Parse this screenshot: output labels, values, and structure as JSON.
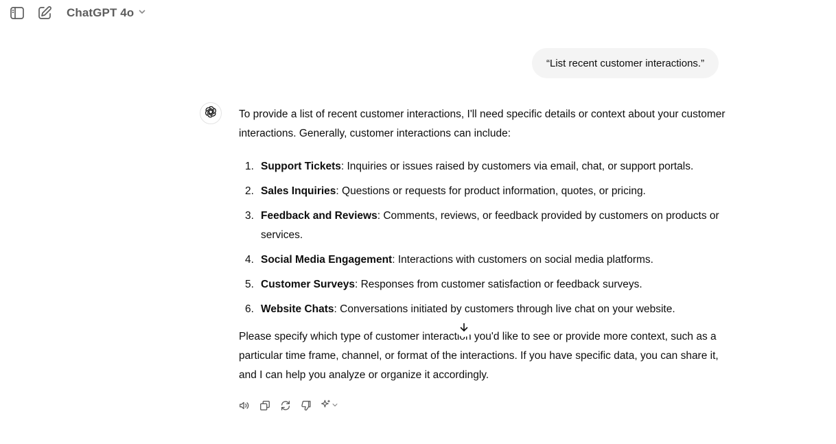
{
  "header": {
    "model_name": "ChatGPT 4o",
    "icons": [
      "sidebar-toggle-icon",
      "new-chat-icon",
      "chevron-down-icon"
    ]
  },
  "conversation": {
    "user_message": "“List recent customer interactions.”",
    "assistant": {
      "intro": "To provide a list of recent customer interactions, I'll need specific details or context about your customer interactions. Generally, customer interactions can include:",
      "items": [
        {
          "number": "1.",
          "title": "Support Tickets",
          "text": ": Inquiries or issues raised by customers via email, chat, or support portals."
        },
        {
          "number": "2.",
          "title": "Sales Inquiries",
          "text": ": Questions or requests for product information, quotes, or pricing."
        },
        {
          "number": "3.",
          "title": "Feedback and Reviews",
          "text": ": Comments, reviews, or feedback provided by customers on products or services."
        },
        {
          "number": "4.",
          "title": "Social Media Engagement",
          "text": ": Interactions with customers on social media platforms."
        },
        {
          "number": "5.",
          "title": "Customer Surveys",
          "text": ": Responses from customer satisfaction or feedback surveys."
        },
        {
          "number": "6.",
          "title": "Website Chats",
          "text": ": Conversations initiated by customers through live chat on your website."
        }
      ],
      "outro": "Please specify which type of customer interaction you'd like to see or provide more context, such as a particular time frame, channel, or format of the interactions. If you have specific data, you can share it, and I can help you analyze or organize it accordingly."
    }
  },
  "actions": [
    "read-aloud-icon",
    "copy-icon",
    "regenerate-icon",
    "thumbs-down-icon",
    "sparkle-icon"
  ],
  "colors": {
    "bubble_bg": "#f4f4f4",
    "text": "#0d0d0d",
    "muted": "#5d5d5d"
  }
}
